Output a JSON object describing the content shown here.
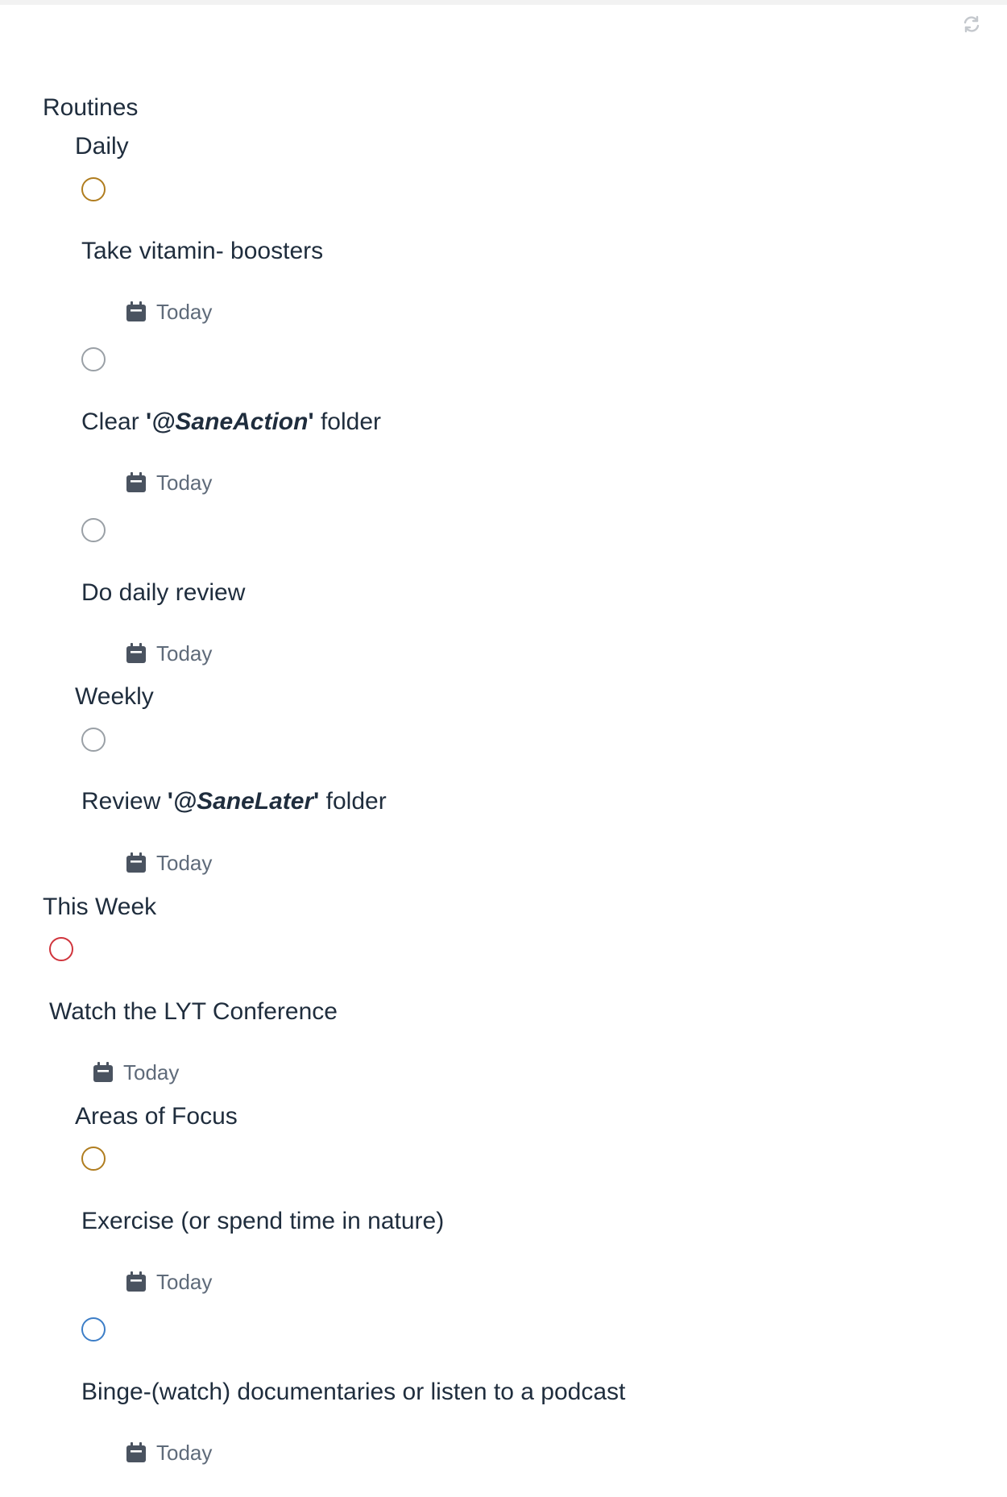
{
  "toolbar": {
    "sync_icon": "sync-icon"
  },
  "colors": {
    "gray": "#9aa0a6",
    "orange": "#b07d1f",
    "red": "#d0343c",
    "blue": "#3d7ec7",
    "text": "#1f2d3d",
    "meta": "#5f6b7a",
    "calendar": "#4a5360"
  },
  "sections": {
    "routines": "Routines",
    "daily": "Daily",
    "weekly": "Weekly",
    "this_week": "This Week",
    "areas_of_focus": "Areas of Focus"
  },
  "tasks": {
    "t1": {
      "text": "Take vitamin- boosters",
      "due": "Today",
      "checkbox_color": "orange"
    },
    "t2": {
      "prefix": "Clear ",
      "quote_open": "'",
      "emph": "@SaneAction",
      "quote_close": "'",
      "suffix": " folder",
      "due": "Today",
      "checkbox_color": "gray"
    },
    "t3": {
      "text": "Do daily review",
      "due": "Today",
      "checkbox_color": "gray"
    },
    "t4": {
      "prefix": "Review ",
      "quote_open": "'",
      "emph": "@SaneLater",
      "quote_close": "'",
      "suffix": " folder",
      "due": "Today",
      "checkbox_color": "gray"
    },
    "t5": {
      "text": "Watch the LYT Conference",
      "due": "Today",
      "checkbox_color": "red"
    },
    "t6": {
      "text": "Exercise (or spend time in nature)",
      "due": "Today",
      "checkbox_color": "orange"
    },
    "t7": {
      "text": "Binge-(watch) documentaries or listen to a podcast",
      "due": "Today",
      "checkbox_color": "blue"
    }
  }
}
